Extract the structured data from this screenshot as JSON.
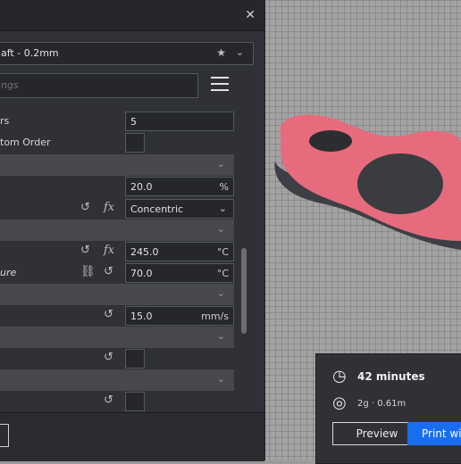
{
  "profile": {
    "label": "aft - 0.2mm"
  },
  "search": {
    "placeholder": "ngs"
  },
  "rows": [
    {
      "label": "rs",
      "value": "5"
    },
    {
      "label": "tom Order"
    },
    {
      "value": "20.0",
      "unit": "%"
    },
    {
      "value": "Concentric"
    },
    {
      "value": "245.0",
      "unit": "°C"
    },
    {
      "label": "ure",
      "value": "70.0",
      "unit": "°C"
    },
    {
      "value": "15.0",
      "unit": "mm/s"
    }
  ],
  "print": {
    "time": "42 minutes",
    "material": "2g · 0.61m",
    "preview": "Preview",
    "print_label": "Print wit"
  },
  "colors": {
    "model": "#e66b7d",
    "accent": "#196ef0"
  }
}
